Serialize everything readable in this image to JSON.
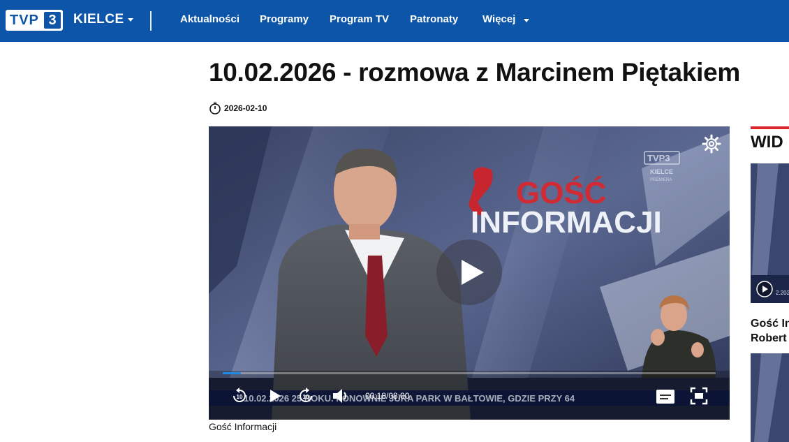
{
  "header": {
    "logo_text": "TVP",
    "logo_number": "3",
    "region": "KIELCE",
    "nav": [
      "Aktualności",
      "Programy",
      "Program TV",
      "Patronaty",
      "Więcej"
    ]
  },
  "article": {
    "title": "10.02.2026 - rozmowa z Marcinem Piętakiem",
    "date": "2026-02-10",
    "caption": "Gość Informacji"
  },
  "video": {
    "show_title_line1": "GOŚĆ",
    "show_title_line2": "INFORMACJI",
    "channel_logo": "TVP3",
    "channel_region": "KIELCE",
    "channel_status": "PREMIERA",
    "ticker": "10.02.2026 25 ROKU. PONOWNIE JURA PARK W BAŁTOWIE, GDZIE PRZY 64",
    "time_current": "00:18",
    "time_total": "08:00",
    "skip_seconds": "10",
    "progress": 0.0375
  },
  "sidebar": {
    "heading": "WID",
    "item1_line1": "Gość In",
    "item1_line2": "Robert",
    "thumb_badge": "2.202"
  },
  "colors": {
    "header_bg": "#0c55a8",
    "accent_red": "#e0222a",
    "progress_blue": "#1e88e5"
  }
}
